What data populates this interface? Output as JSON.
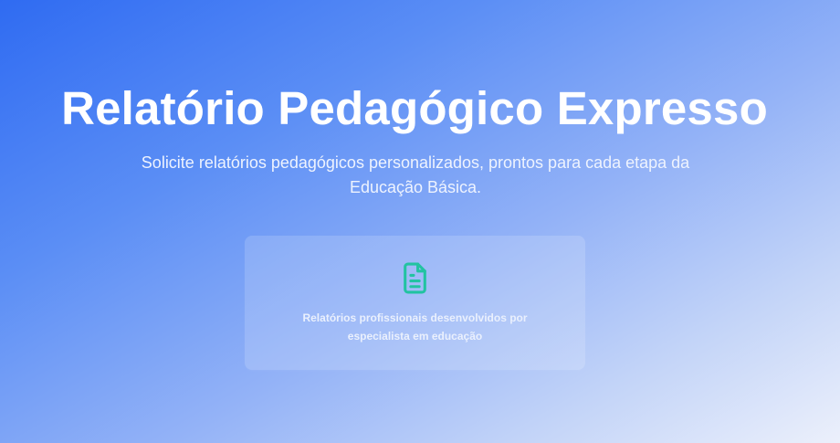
{
  "hero": {
    "title": "Relatório Pedagógico Expresso",
    "subtitle": "Solicite relatórios pedagógicos personalizados, prontos para cada etapa da Educação Básica."
  },
  "feature_card": {
    "icon": "document-icon",
    "icon_color": "#22c3a1",
    "text": "Relatórios profissionais desenvolvidos por especialista em educação"
  },
  "colors": {
    "background_start": "#2f6bf2",
    "background_end": "#ecf0fb",
    "text": "#ffffff"
  }
}
